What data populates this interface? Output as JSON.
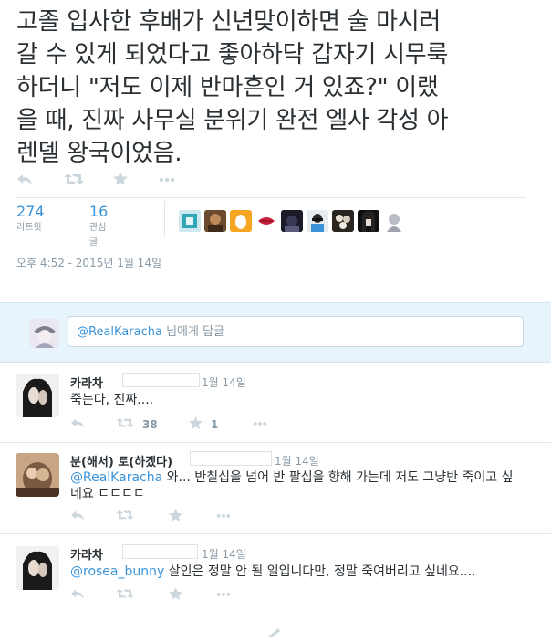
{
  "tweet": {
    "text_lines": [
      "고졸 입사한 후배가 신년맞이하면 술 마시러",
      "갈 수 있게 되었다고 좋아하닥 갑자기 시무룩",
      "하더니 \"저도 이제 반마흔인 거 있죠?\" 이랬",
      "을 때, 진짜 사무실 분위기 완전 엘사 각성 아",
      "렌델 왕국이었음."
    ],
    "retweets": {
      "count": "274",
      "label": "리트윗"
    },
    "favorites": {
      "count": "16",
      "label": "관심글"
    },
    "timestamp": "오후 4:52 - 2015년 1월 14일"
  },
  "reply_box": {
    "mention": "@RealKaracha",
    "suffix": " 님에게 답글"
  },
  "replies": [
    {
      "name": "카라차",
      "date": "1월 14일",
      "text": "죽는다, 진짜....",
      "mention": "",
      "retweets": "38",
      "favorites": "1"
    },
    {
      "name": "분(해서) 토(하겠다)",
      "date": "1월 14일",
      "mention": "@RealKaracha",
      "text": " 와... 반칠십을 넘어 반 팔십을 향해 가는데 저도 그냥반 죽이고 싶",
      "text2": "네요 ㄷㄷㄷㄷ",
      "retweets": "",
      "favorites": ""
    },
    {
      "name": "카라차",
      "date": "1월 14일",
      "mention": "@rosea_bunny",
      "text": " 살인은 정말 안 될 일입니다만, 정말 죽여버리고 싶네요....",
      "retweets": "",
      "favorites": ""
    }
  ],
  "colors": {
    "accent": "#3b94d9",
    "muted": "#8899a6",
    "icon": "#ccd6dd",
    "reply_bg": "#e8f4fb"
  },
  "icons": [
    "reply-icon",
    "retweet-icon",
    "favorite-icon",
    "more-icon",
    "twitter-bird-icon"
  ]
}
